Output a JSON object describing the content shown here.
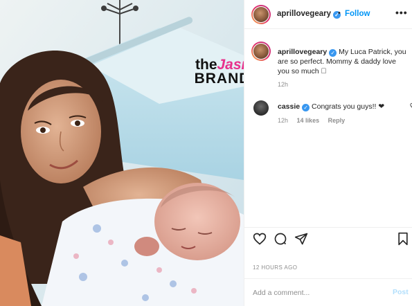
{
  "photo": {
    "alt": "New mom holding newborn in hospital bed",
    "watermark": {
      "line1_a": "the",
      "line1_b": "Jasmine",
      "line2": "BRAND"
    }
  },
  "header": {
    "username": "aprillovegeary",
    "verified_icon": "verified-badge-icon",
    "separator": "•",
    "follow_label": "Follow",
    "more_label": "•••"
  },
  "caption": {
    "username": "aprillovegeary",
    "text": " My Luca Patrick, you are so perfect. Mommy & daddy love you so much 🏻",
    "time": "12h"
  },
  "comment": {
    "username": "cassie",
    "text": " Congrats you guys!! ❤",
    "time": "12h",
    "likes": "14 likes",
    "reply": "Reply"
  },
  "actions": {
    "icons": [
      "heart-icon",
      "comment-icon",
      "share-icon",
      "bookmark-icon"
    ],
    "posted": "12 HOURS AGO"
  },
  "add_comment": {
    "placeholder": "Add a comment...",
    "post_label": "Post",
    "post_color": "#b2dffc"
  },
  "colors": {
    "accent": "#0095f6",
    "verified": "#3897f0",
    "watermark_pink": "#e8318c"
  }
}
